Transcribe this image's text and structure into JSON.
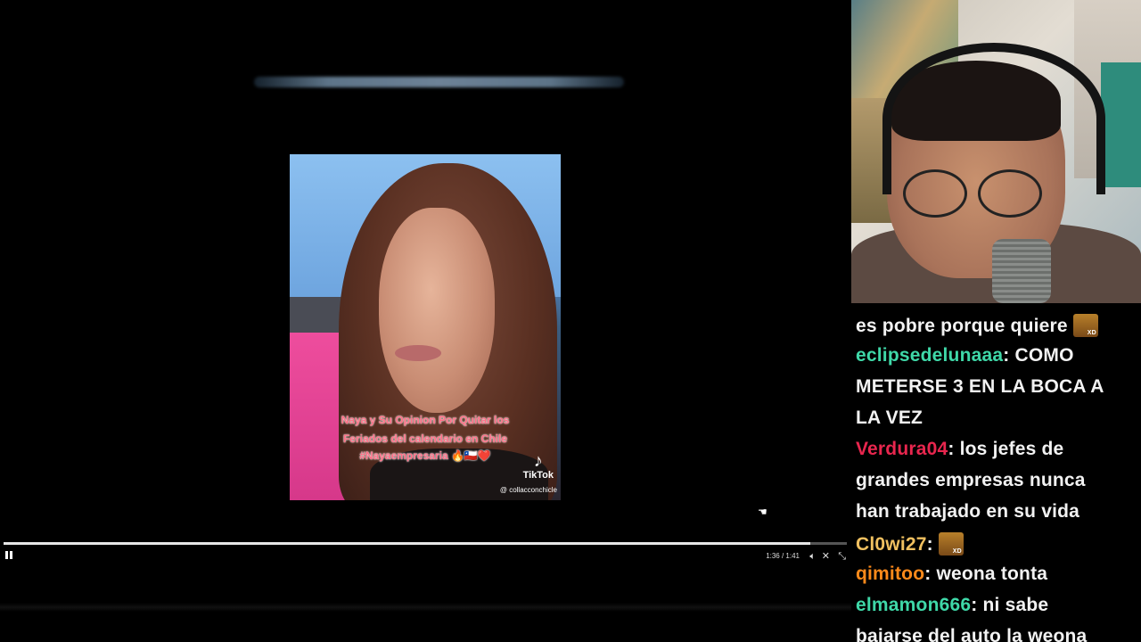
{
  "player": {
    "video": {
      "captions": [
        "Naya y Su Opinion Por Quitar los",
        "Feriados del calendario  en Chile",
        "#Nayaempresaria 🔥🇨🇱❤️"
      ],
      "watermark_brand": "TikTok",
      "watermark_user": "@ collacconchicle"
    },
    "progress": {
      "fraction": 0.957
    },
    "time_display": "1:36 / 1:41",
    "controls": {
      "pause_icon": "pause-icon",
      "volume_icon": "volume-icon",
      "x_icon": "x-logo-icon",
      "minimize_icon": "minimize-icon"
    }
  },
  "chat": {
    "messages": [
      {
        "user": "",
        "text": "es pobre porque quiere",
        "emote": "xd-emote",
        "color": "#ffffff"
      },
      {
        "user": "eclipsedelunaaa",
        "text": " COMO",
        "color": "#3fd8a8"
      },
      {
        "user": "",
        "text": "METERSE 3 EN LA BOCA A",
        "color": "#ffffff"
      },
      {
        "user": "",
        "text": "LA VEZ",
        "color": "#ffffff"
      },
      {
        "user": "Verdura04",
        "text": " los jefes de",
        "color": "#e8264e"
      },
      {
        "user": "",
        "text": "grandes empresas nunca",
        "color": "#ffffff"
      },
      {
        "user": "",
        "text": "han trabajado en su vida",
        "color": "#ffffff"
      },
      {
        "user": "Cl0wi27",
        "text": "",
        "emote": "xd-emote",
        "color": "#f0c060"
      },
      {
        "user": "qimitoo",
        "text": " weona tonta",
        "color": "#ff8a1a"
      },
      {
        "user": "elmamon666",
        "text": " ni sabe",
        "color": "#3fd8a8"
      },
      {
        "user": "",
        "text": "bajarse del auto la weona",
        "color": "#ffffff"
      }
    ]
  }
}
